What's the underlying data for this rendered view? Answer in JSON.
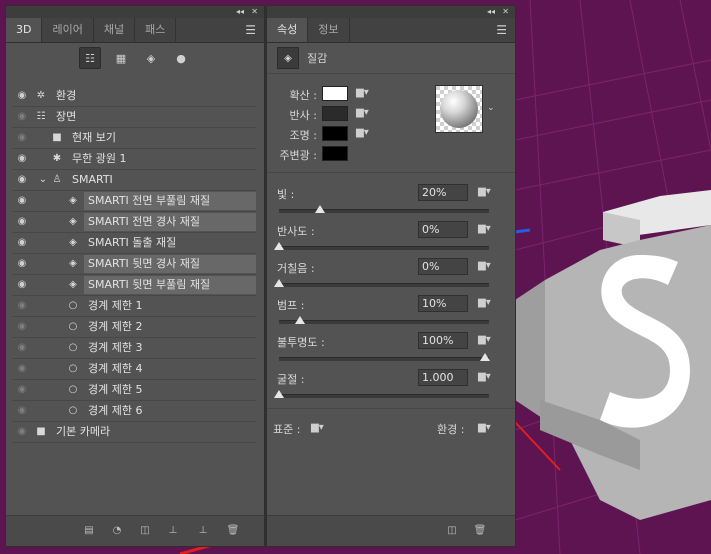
{
  "left_panel": {
    "tabs": [
      "3D",
      "레이어",
      "채널",
      "패스"
    ],
    "active_tab": 0,
    "toolbar_icons": [
      "scene-filter-icon",
      "mesh-filter-icon",
      "material-filter-icon",
      "light-filter-icon"
    ],
    "items": [
      {
        "label": "환경",
        "icon": "environment-icon",
        "indent": 0,
        "visible": true,
        "highlight": false
      },
      {
        "label": "장면",
        "icon": "scene-icon",
        "indent": 0,
        "visible": false,
        "highlight": false
      },
      {
        "label": "현재 보기",
        "icon": "camera-icon",
        "indent": 1,
        "visible": false,
        "highlight": false
      },
      {
        "label": "무한 광원 1",
        "icon": "light-icon",
        "indent": 1,
        "visible": true,
        "highlight": false
      },
      {
        "label": "SMARTI",
        "icon": "mesh-icon",
        "indent": 1,
        "visible": true,
        "highlight": false,
        "expanded": true
      },
      {
        "label": "SMARTI 전면 부풀림 재질",
        "icon": "material-icon",
        "indent": 2,
        "visible": true,
        "highlight": true
      },
      {
        "label": "SMARTI 전면 경사 재질",
        "icon": "material-icon",
        "indent": 2,
        "visible": true,
        "highlight": true
      },
      {
        "label": "SMARTI 돌출 재질",
        "icon": "material-icon",
        "indent": 2,
        "visible": true,
        "highlight": false
      },
      {
        "label": "SMARTI 뒷면 경사 재질",
        "icon": "material-icon",
        "indent": 2,
        "visible": true,
        "highlight": true
      },
      {
        "label": "SMARTI 뒷면 부풀림 재질",
        "icon": "material-icon",
        "indent": 2,
        "visible": true,
        "highlight": true
      },
      {
        "label": "경계 제한 1",
        "icon": "constraint-icon",
        "indent": 2,
        "visible": false,
        "highlight": false
      },
      {
        "label": "경계 제한 2",
        "icon": "constraint-icon",
        "indent": 2,
        "visible": false,
        "highlight": false
      },
      {
        "label": "경계 제한 3",
        "icon": "constraint-icon",
        "indent": 2,
        "visible": false,
        "highlight": false
      },
      {
        "label": "경계 제한 4",
        "icon": "constraint-icon",
        "indent": 2,
        "visible": false,
        "highlight": false
      },
      {
        "label": "경계 제한 5",
        "icon": "constraint-icon",
        "indent": 2,
        "visible": false,
        "highlight": false
      },
      {
        "label": "경계 제한 6",
        "icon": "constraint-icon",
        "indent": 2,
        "visible": false,
        "highlight": false
      },
      {
        "label": "기본 카메라",
        "icon": "camera-icon",
        "indent": 0,
        "visible": false,
        "highlight": false
      }
    ],
    "bottom_icons": [
      "mesh-add-icon",
      "light-add-icon",
      "material-add-icon",
      "ground-icon",
      "constraint-add-icon",
      "trash-icon"
    ]
  },
  "right_panel": {
    "tabs": [
      "속성",
      "정보"
    ],
    "active_tab": 0,
    "header_label": "질감",
    "swatches": [
      {
        "label": "확산 :",
        "color": "#ffffff"
      },
      {
        "label": "반사 :",
        "color": "#2b2b2b"
      },
      {
        "label": "조명 :",
        "color": "#000000"
      },
      {
        "label": "주변광 :",
        "color": "#000000"
      }
    ],
    "sliders": [
      {
        "label": "빛 :",
        "value": "20%",
        "fraction": 0.2
      },
      {
        "label": "반사도 :",
        "value": "0%",
        "fraction": 0.0
      },
      {
        "label": "거칠음 :",
        "value": "0%",
        "fraction": 0.0
      },
      {
        "label": "범프 :",
        "value": "10%",
        "fraction": 0.1
      },
      {
        "label": "불투명도 :",
        "value": "100%",
        "fraction": 1.0
      },
      {
        "label": "굴절 :",
        "value": "1.000",
        "fraction": 0.0
      }
    ],
    "footer": {
      "normal_label": "표준 :",
      "env_label": "환경 :"
    },
    "bottom_icons": [
      "material-add-icon",
      "trash-icon"
    ]
  },
  "colors": {
    "canvas_bg": "#6b1a5a",
    "panel_bg": "#535353",
    "highlight_row": "#686868"
  }
}
